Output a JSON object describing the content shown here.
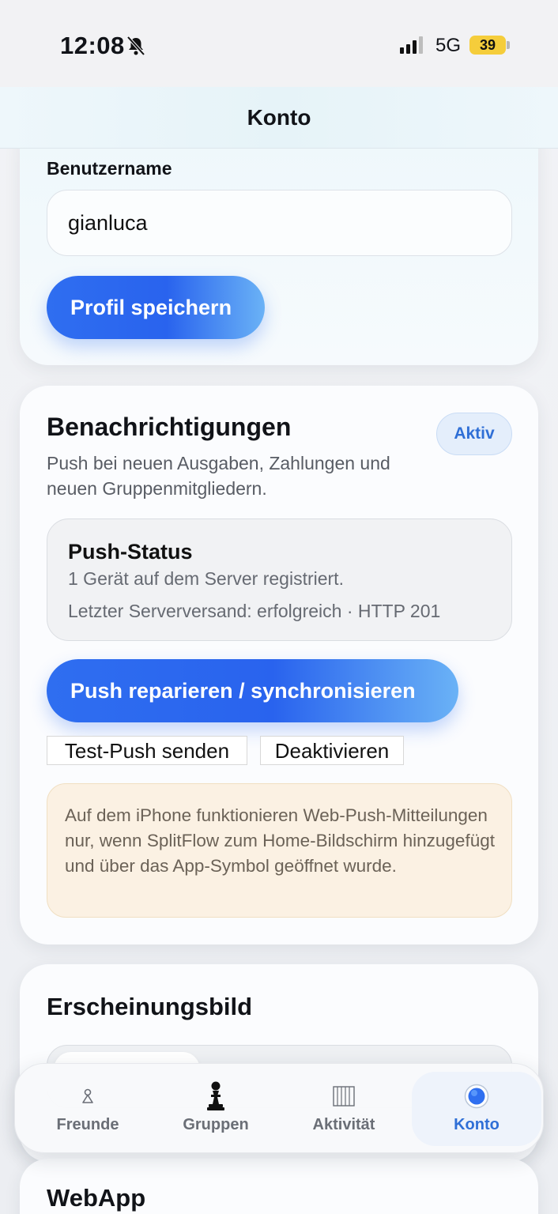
{
  "status_bar": {
    "time": "12:08",
    "network": "5G",
    "battery": "39",
    "icons": [
      "bell-slash-icon",
      "signal-icon",
      "battery-icon"
    ]
  },
  "header": {
    "title": "Konto"
  },
  "profile": {
    "username_label": "Benutzername",
    "username_value": "gianluca",
    "save_button": "Profil speichern"
  },
  "notifications": {
    "title": "Benachrichtigungen",
    "badge": "Aktiv",
    "description": "Push bei neuen Ausgaben, Zahlungen und neuen Gruppenmitgliedern.",
    "push_status": {
      "title": "Push-Status",
      "line1": "1 Gerät auf dem Server registriert.",
      "line2": "Letzter Serverversand: erfolgreich · HTTP 201"
    },
    "repair_button": "Push reparieren / synchronisieren",
    "test_button": "Test-Push senden",
    "deactivate_button": "Deaktivieren",
    "hint": "Auf dem iPhone funktionieren Web-Push-Mitteilungen nur, wenn SplitFlow zum Home-Bildschirm hinzugefügt und über das App-Symbol geöffnet wurde."
  },
  "appearance": {
    "title": "Erscheinungsbild"
  },
  "webapp": {
    "title": "WebApp"
  },
  "tabbar": {
    "active": "Konto",
    "tabs": [
      {
        "label": "Freunde",
        "icon": "person-icon"
      },
      {
        "label": "Gruppen",
        "icon": "chess-pawn-icon"
      },
      {
        "label": "Aktivität",
        "icon": "columns-icon"
      },
      {
        "label": "Konto",
        "icon": "blue-circle-icon"
      }
    ]
  },
  "colors": {
    "accent": "#2f6ff0",
    "accent_light": "#6ab2f6",
    "badge_text": "#2f6fd6",
    "hint_background": "#fbf1e3",
    "battery": "#f5cd3b"
  }
}
